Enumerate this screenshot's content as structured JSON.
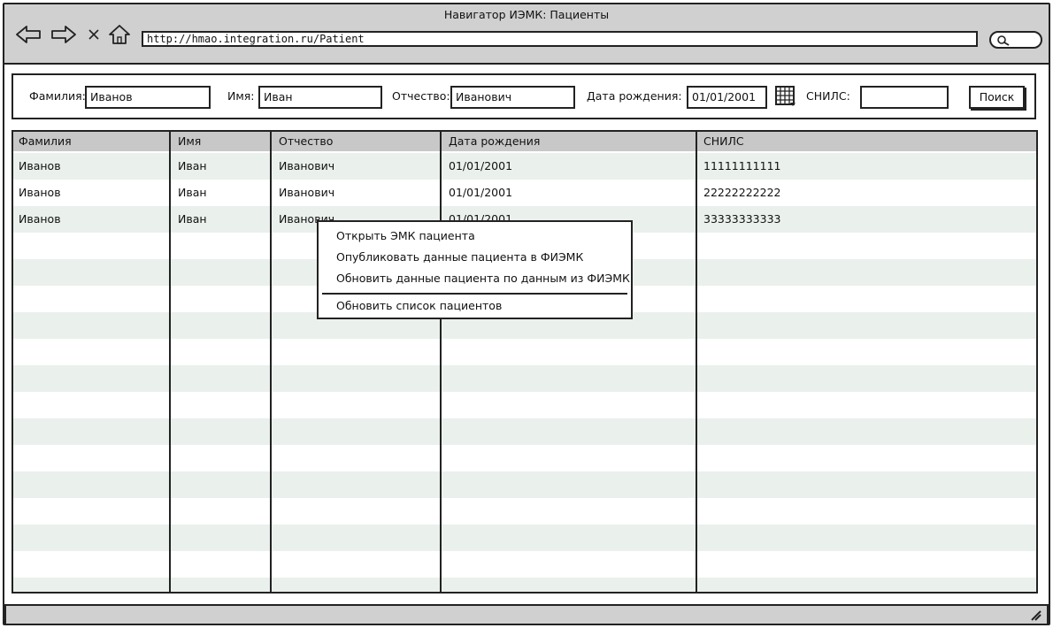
{
  "window": {
    "title": "Навигатор ИЭМК: Пациенты",
    "url": "http://hmao.integration.ru/Patient"
  },
  "nav_icons": [
    "back-arrow-icon",
    "forward-arrow-icon",
    "close-icon",
    "home-icon",
    "search-icon"
  ],
  "filters": {
    "lastname_label": "Фамилия:",
    "lastname_value": "Иванов",
    "firstname_label": "Имя:",
    "firstname_value": "Иван",
    "middlename_label": "Отчество:",
    "middlename_value": "Иванович",
    "birthdate_label": "Дата рождения:",
    "birthdate_value": "01/01/2001",
    "snils_label": "СНИЛС:",
    "snils_value": "",
    "search_button": "Поиск"
  },
  "table": {
    "columns": [
      "Фамилия",
      "Имя",
      "Отчество",
      "Дата рождения",
      "СНИЛС"
    ],
    "rows": [
      [
        "Иванов",
        "Иван",
        "Иванович",
        "01/01/2001",
        "11111111111"
      ],
      [
        "Иванов",
        "Иван",
        "Иванович",
        "01/01/2001",
        "22222222222"
      ],
      [
        "Иванов",
        "Иван",
        "Иванович",
        "01/01/2001",
        "33333333333"
      ]
    ]
  },
  "context_menu": {
    "items": [
      "Открыть ЭМК пациента",
      "Опубликовать данные пациента в ФИЭМК",
      "Обновить данные пациента по данным из ФИЭМК",
      "Обновить список пациентов"
    ]
  },
  "colors": {
    "chrome": "#d0d0d0",
    "header": "#c8c8c8",
    "alt_row": "#eaf0ec",
    "border": "#222222"
  }
}
